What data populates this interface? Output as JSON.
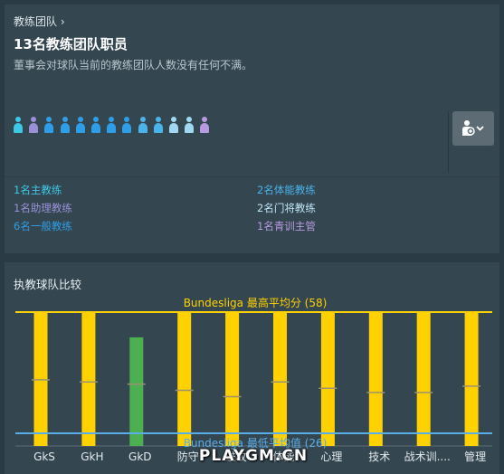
{
  "header": {
    "breadcrumb": "教练团队 ›",
    "title": "13名教练团队职员",
    "subtitle": "董事会对球队当前的教练团队人数没有任何不满。"
  },
  "staff_icons": [
    {
      "role": "head_coach",
      "color": "#3ec8e8"
    },
    {
      "role": "assistant",
      "color": "#9a8fd8"
    },
    {
      "role": "coach",
      "color": "#2f9ee8"
    },
    {
      "role": "coach",
      "color": "#2f9ee8"
    },
    {
      "role": "coach",
      "color": "#2f9ee8"
    },
    {
      "role": "coach",
      "color": "#2f9ee8"
    },
    {
      "role": "coach",
      "color": "#2f9ee8"
    },
    {
      "role": "coach",
      "color": "#2f9ee8"
    },
    {
      "role": "fitness",
      "color": "#49b3ea"
    },
    {
      "role": "fitness",
      "color": "#49b3ea"
    },
    {
      "role": "goalkeeping",
      "color": "#9fd8f0"
    },
    {
      "role": "goalkeeping",
      "color": "#9fd8f0"
    },
    {
      "role": "youth",
      "color": "#b79ae2"
    }
  ],
  "roles": {
    "head_coach": {
      "label": "1名主教练",
      "color": "#3ec8e8"
    },
    "assistant": {
      "label": "1名助理教练",
      "color": "#9a8fd8"
    },
    "coach": {
      "label": "6名一般教练",
      "color": "#2f9ee8"
    },
    "fitness": {
      "label": "2名体能教练",
      "color": "#49b3ea"
    },
    "goalkeeping": {
      "label": "2名门将教练",
      "color": "#bfe6f5"
    },
    "youth": {
      "label": "1名青训主管",
      "color": "#b79ae2"
    }
  },
  "filter_button": {
    "icon": "staff-filter-icon"
  },
  "comparison": {
    "section_title": "执教球队比较",
    "max_line_label": "Bundesliga 最高平均分 (58)",
    "min_line_label": "Bundesliga 最低平均值 (26)"
  },
  "chart_data": {
    "type": "bar",
    "categories": [
      "GkS",
      "GkH",
      "GkD",
      "防守",
      "进攻",
      "体能",
      "心理",
      "技术",
      "战术训....",
      "管理"
    ],
    "values": [
      58,
      58,
      46,
      58,
      58,
      58,
      58,
      58,
      58,
      58
    ],
    "league_average": [
      43,
      42,
      41,
      38,
      35,
      42,
      39,
      37,
      37,
      40
    ],
    "bar_colors": [
      "#ffd100",
      "#ffd100",
      "#4caf50",
      "#ffd100",
      "#ffd100",
      "#ffd100",
      "#ffd100",
      "#ffd100",
      "#ffd100",
      "#ffd100"
    ],
    "reference_lines": [
      {
        "label": "Bundesliga 最高平均分 (58)",
        "value": 58,
        "color": "#ffd100"
      },
      {
        "label": "Bundesliga 最低平均值 (26)",
        "value": 26,
        "color": "#5aaee8"
      }
    ],
    "ylim": [
      0,
      58
    ],
    "grid": false,
    "title": "执教球队比较"
  },
  "watermark": "PLAYGM.CN"
}
